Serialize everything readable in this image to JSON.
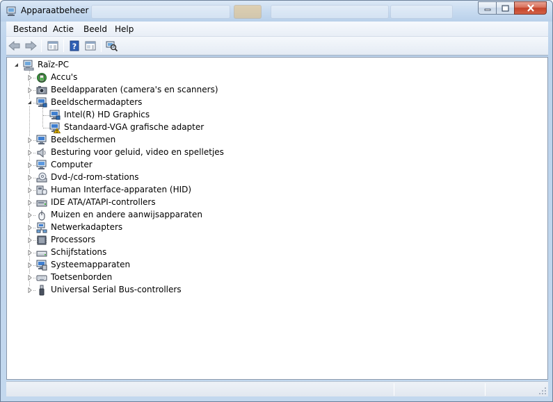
{
  "window": {
    "title": "Apparaatbeheer",
    "icon": "device-manager-icon"
  },
  "menubar": {
    "items": [
      "Bestand",
      "Actie",
      "Beeld",
      "Help"
    ]
  },
  "toolbar": {
    "buttons": [
      "back-icon",
      "forward-icon",
      "show-hide-console-tree-icon",
      "help-icon",
      "properties-icon",
      "scan-hardware-icon"
    ]
  },
  "tree": {
    "root": "Raïz-PC",
    "items": [
      {
        "label": "Accu's",
        "icon": "battery-icon",
        "expanded": false
      },
      {
        "label": "Beeldapparaten (camera's en scanners)",
        "icon": "camera-icon",
        "expanded": false
      },
      {
        "label": "Beeldschermadapters",
        "icon": "display-adapter-icon",
        "expanded": true,
        "children": [
          {
            "label": "Intel(R) HD Graphics",
            "icon": "display-adapter-icon",
            "warning": false
          },
          {
            "label": "Standaard-VGA grafische adapter",
            "icon": "display-adapter-warning-icon",
            "warning": true
          }
        ]
      },
      {
        "label": "Beeldschermen",
        "icon": "monitor-icon",
        "expanded": false
      },
      {
        "label": "Besturing voor geluid, video en spelletjes",
        "icon": "speaker-icon",
        "expanded": false
      },
      {
        "label": "Computer",
        "icon": "computer-icon",
        "expanded": false
      },
      {
        "label": "Dvd-/cd-rom-stations",
        "icon": "optical-drive-icon",
        "expanded": false
      },
      {
        "label": "Human Interface-apparaten (HID)",
        "icon": "hid-icon",
        "expanded": false
      },
      {
        "label": "IDE ATA/ATAPI-controllers",
        "icon": "ide-controller-icon",
        "expanded": false
      },
      {
        "label": "Muizen en andere aanwijsapparaten",
        "icon": "mouse-icon",
        "expanded": false
      },
      {
        "label": "Netwerkadapters",
        "icon": "network-adapter-icon",
        "expanded": false
      },
      {
        "label": "Processors",
        "icon": "processor-icon",
        "expanded": false
      },
      {
        "label": "Schijfstations",
        "icon": "disk-drive-icon",
        "expanded": false
      },
      {
        "label": "Systeemapparaten",
        "icon": "system-device-icon",
        "expanded": false
      },
      {
        "label": "Toetsenborden",
        "icon": "keyboard-icon",
        "expanded": false
      },
      {
        "label": "Universal Serial Bus-controllers",
        "icon": "usb-icon",
        "expanded": false
      }
    ]
  },
  "colors": {
    "warning": "#f2c200",
    "title_bg": "#c8dbf0",
    "close_button": "#c4432a"
  }
}
